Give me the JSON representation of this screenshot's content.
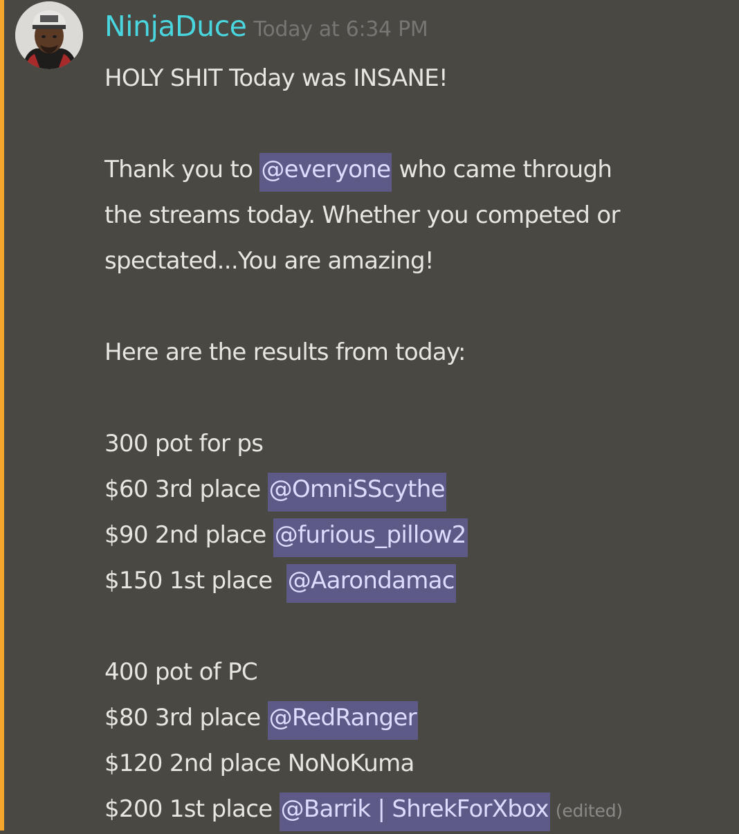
{
  "message": {
    "author": "NinjaDuce",
    "timestamp": "Today at 6:34 PM",
    "edited_label": "(edited)",
    "avatar_icon": "user-avatar",
    "colors": {
      "username": "#49d6df",
      "mention_bg": "#5e5a88",
      "mention_text": "#dcdcff",
      "highlight_bar": "#f2a52a",
      "background": "#4a4843"
    },
    "lines": {
      "l1": "HOLY SHIT Today was INSANE!",
      "l2_before": "Thank you to ",
      "l2_mention": "@everyone",
      "l2_after": " who came through",
      "l3": "the streams today. Whether you competed or",
      "l4": "spectated...You are amazing!",
      "l5": "Here are the results from today:",
      "ps_header": "300 pot for ps",
      "ps_3rd_prefix": "$60 3rd place ",
      "ps_3rd_mention": "@OmniSScythe",
      "ps_2nd_prefix": "$90 2nd place ",
      "ps_2nd_mention": "@furious_pillow2",
      "ps_1st_prefix": "$150 1st place  ",
      "ps_1st_mention": "@Aarondamac",
      "pc_header": "400 pot of PC",
      "pc_3rd_prefix": "$80 3rd place ",
      "pc_3rd_mention": "@RedRanger",
      "pc_2nd": "$120 2nd place NoNoKuma",
      "pc_1st_prefix": "$200 1st place ",
      "pc_1st_mention": "@Barrik | ShrekForXbox"
    }
  }
}
